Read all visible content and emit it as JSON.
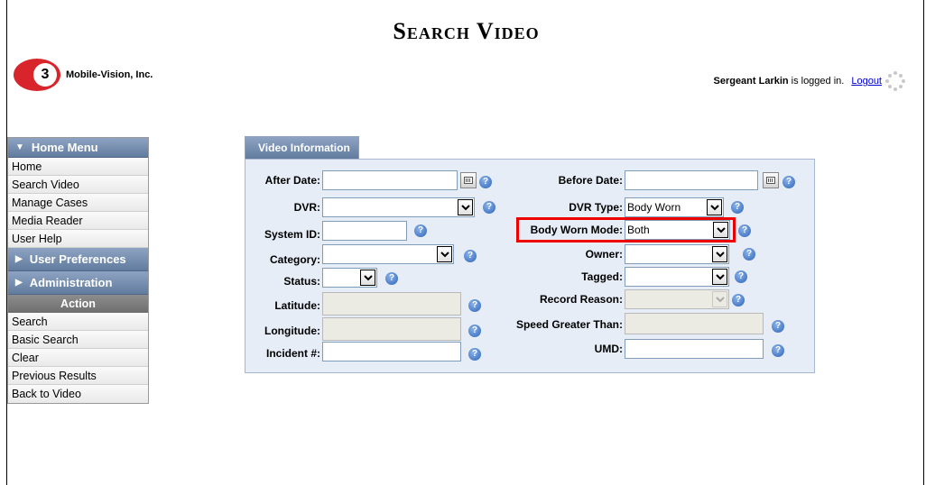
{
  "header": {
    "title": "Search Video",
    "logo_text": "Mobile-Vision, Inc.",
    "logo_mark": "3",
    "user_name": "Sergeant Larkin",
    "logged_in_text": "is logged in.",
    "logout_label": "Logout"
  },
  "sidebar": {
    "home_menu": {
      "label": "Home Menu",
      "items": [
        "Home",
        "Search Video",
        "Manage Cases",
        "Media Reader",
        "User Help"
      ]
    },
    "user_preferences_label": "User Preferences",
    "administration_label": "Administration",
    "action": {
      "label": "Action",
      "items": [
        "Search",
        "Basic Search",
        "Clear",
        "Previous Results",
        "Back to Video"
      ]
    }
  },
  "tab": {
    "label": "Video Information"
  },
  "form": {
    "after_date": {
      "label": "After Date:",
      "value": ""
    },
    "before_date": {
      "label": "Before Date:",
      "value": ""
    },
    "dvr": {
      "label": "DVR:",
      "value": ""
    },
    "dvr_type": {
      "label": "DVR Type:",
      "value": "Body Worn"
    },
    "system_id": {
      "label": "System ID:",
      "value": ""
    },
    "body_worn_mode": {
      "label": "Body Worn Mode:",
      "value": "Both"
    },
    "category": {
      "label": "Category:",
      "value": ""
    },
    "owner": {
      "label": "Owner:",
      "value": ""
    },
    "status": {
      "label": "Status:",
      "value": ""
    },
    "tagged": {
      "label": "Tagged:",
      "value": ""
    },
    "latitude": {
      "label": "Latitude:",
      "value": ""
    },
    "record_reason": {
      "label": "Record Reason:",
      "value": ""
    },
    "longitude": {
      "label": "Longitude:",
      "value": ""
    },
    "speed_greater_than": {
      "label": "Speed Greater Than:",
      "value": ""
    },
    "incident": {
      "label": "Incident #:",
      "value": ""
    },
    "umd": {
      "label": "UMD:",
      "value": ""
    },
    "help_glyph": "?"
  },
  "colors": {
    "highlight": "#e00000",
    "menu_header": "#617c9f",
    "panel_bg": "#e6edf7"
  },
  "icons": [
    "help-icon",
    "calendar-icon",
    "chevron-down-icon",
    "loading-spinner-icon"
  ]
}
